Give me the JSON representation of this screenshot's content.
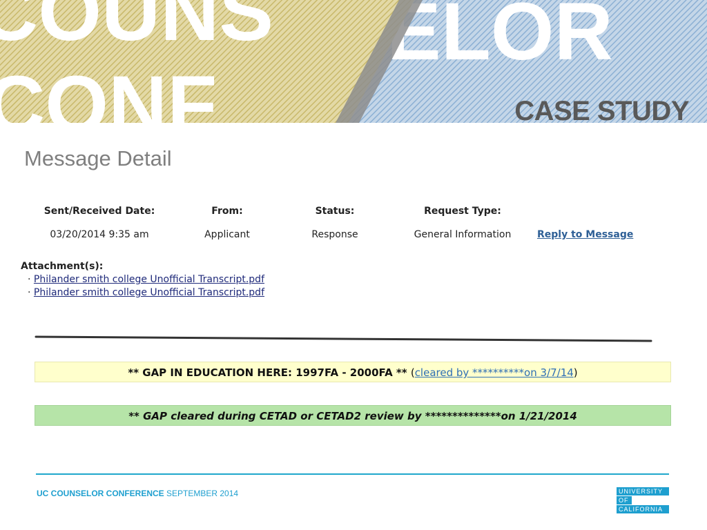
{
  "banner": {
    "line1_left": "COUNS",
    "line1_right": "ELOR",
    "line2": "CONF",
    "subtitle": "CASE STUDY"
  },
  "page_title": "Message Detail",
  "message": {
    "headers": {
      "sent_received_date": "Sent/Received Date:",
      "from": "From:",
      "status": "Status:",
      "request_type": "Request Type:"
    },
    "values": {
      "sent_received_date": "03/20/2014 9:35 am",
      "from": "Applicant",
      "status": "Response",
      "request_type": "General Information"
    },
    "reply_link": "Reply to Message"
  },
  "attachments": {
    "label": "Attachment(s):",
    "bullet": "·",
    "items": [
      "Philander smith college Unofficial Transcript.pdf",
      "Philander smith college Unofficial Transcript.pdf"
    ]
  },
  "gap_notice": {
    "text": "** GAP IN EDUCATION HERE: 1997FA - 2000FA **",
    "open_paren": "(",
    "link": "cleared by **********on 3/7/14",
    "close_paren": ")"
  },
  "cleared_notice": {
    "text": "** GAP cleared during CETAD or CETAD2 review by **************on 1/21/2014"
  },
  "footer": {
    "conference": "UC COUNSELOR CONFERENCE",
    "date": "SEPTEMBER 2014"
  },
  "logo": {
    "line1": "UNIVERSITY",
    "line2": "OF",
    "line3": "CALIFORNIA"
  },
  "colors": {
    "gold": "#c8b86a",
    "blue": "#8cb0d4",
    "accent": "#1e9fcf",
    "link": "#2e5f96",
    "gap_bg": "#ffffcc",
    "cleared_bg": "#b6e4a8"
  }
}
